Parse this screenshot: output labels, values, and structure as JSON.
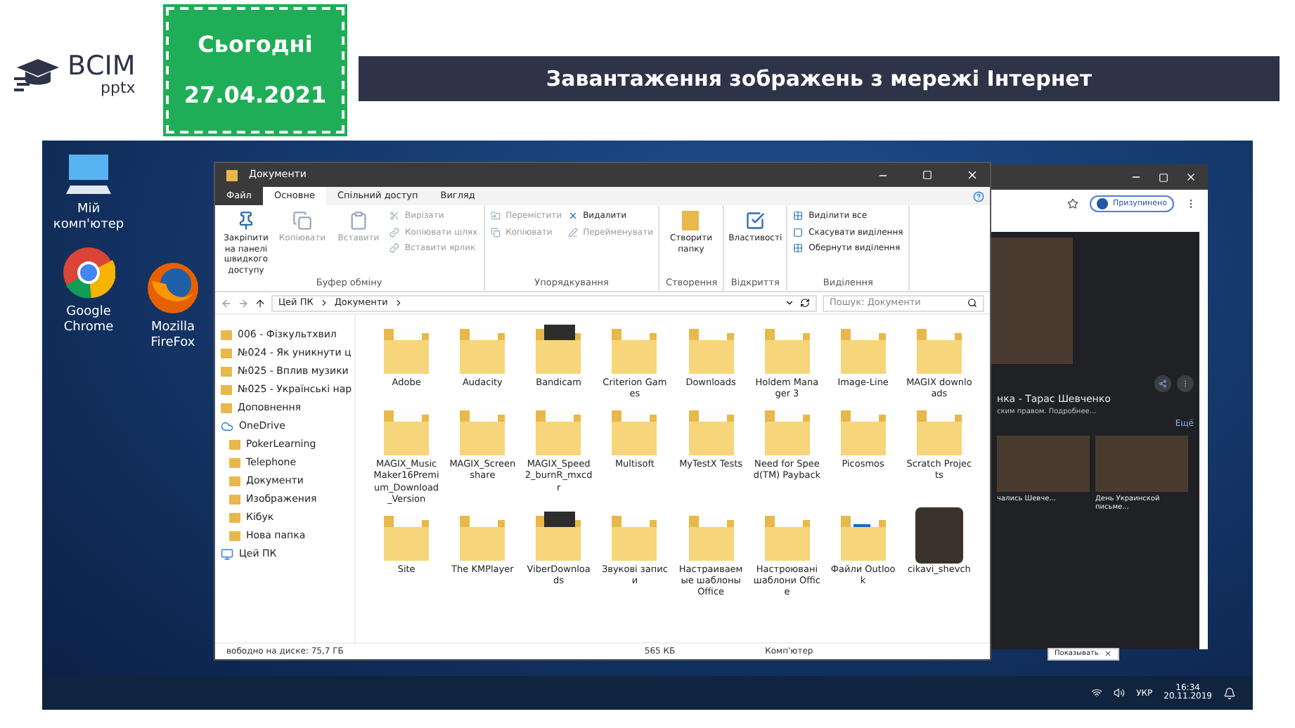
{
  "logo": {
    "title": "ВСІМ",
    "subtitle": "pptx"
  },
  "date_card": {
    "label": "Сьогодні",
    "date": "27.04.2021"
  },
  "title": "Завантаження зображень з мережі Інтернет",
  "desktop_icons": [
    {
      "kind": "computer",
      "label": "Мій комп'ютер"
    },
    {
      "kind": "chrome",
      "label": "Google Chrome"
    },
    {
      "kind": "firefox",
      "label": "Mozilla FireFox"
    }
  ],
  "explorer": {
    "title": "Документи",
    "tabs": [
      {
        "label": "Файл",
        "kind": "file",
        "selected": false
      },
      {
        "label": "Основне",
        "kind": "tab",
        "selected": true
      },
      {
        "label": "Спільний доступ",
        "kind": "tab",
        "selected": false
      },
      {
        "label": "Вигляд",
        "kind": "tab",
        "selected": false
      }
    ],
    "ribbon": [
      {
        "label": "Буфер обміну",
        "items": [
          {
            "kind": "pin",
            "label": "Закріпити на панелі швидкого доступу",
            "disabled": false
          },
          {
            "kind": "copy",
            "label": "Копіювати",
            "disabled": true
          },
          {
            "kind": "paste",
            "label": "Вставити",
            "disabled": true
          },
          {
            "kind": "cut",
            "label": "Вирізати",
            "disabled": true
          },
          {
            "kind": "path",
            "label": "Копіювати шлях",
            "disabled": true
          },
          {
            "kind": "shortcut",
            "label": "Вставити ярлик",
            "disabled": true
          }
        ]
      },
      {
        "label": "Упорядкування",
        "items": [
          {
            "kind": "move",
            "label": "Перемістити",
            "disabled": true
          },
          {
            "kind": "copyto",
            "label": "Копіювати",
            "disabled": true
          },
          {
            "kind": "delete",
            "label": "Видалити",
            "disabled": false
          },
          {
            "kind": "rename",
            "label": "Перейменувати",
            "disabled": true
          }
        ]
      },
      {
        "label": "Створення",
        "items": [
          {
            "kind": "newfolder",
            "label": "Створити папку",
            "disabled": false
          }
        ]
      },
      {
        "label": "Відкриття",
        "items": [
          {
            "kind": "properties",
            "label": "Властивості",
            "disabled": false
          }
        ]
      },
      {
        "label": "Виділення",
        "items": [
          {
            "kind": "selectall",
            "label": "Виділити все",
            "disabled": false
          },
          {
            "kind": "selectnone",
            "label": "Скасувати виділення",
            "disabled": false
          },
          {
            "kind": "invert",
            "label": "Обернути виділення",
            "disabled": false
          }
        ]
      }
    ],
    "breadcrumb": [
      "Цей ПК",
      "Документи"
    ],
    "search": {
      "placeholder": "Пошук: Документи"
    },
    "nav": [
      {
        "label": "006 - Фізкультхвил",
        "kind": "folder"
      },
      {
        "label": "№024 - Як уникнути ц",
        "kind": "folder"
      },
      {
        "label": "№025 - Вплив музики",
        "kind": "folder"
      },
      {
        "label": "№025 - Українські нар",
        "kind": "folder"
      },
      {
        "label": "Доповнення",
        "kind": "folder"
      },
      {
        "label": "OneDrive",
        "kind": "cloud",
        "children": [
          {
            "label": "PokerLearning",
            "kind": "folder"
          },
          {
            "label": "Telephone",
            "kind": "folder"
          },
          {
            "label": "Документи",
            "kind": "folder"
          },
          {
            "label": "Изображения",
            "kind": "folder"
          },
          {
            "label": "Кібук",
            "kind": "folder"
          },
          {
            "label": "Нова папка",
            "kind": "folder"
          }
        ]
      },
      {
        "label": "Цей ПК",
        "kind": "pc"
      }
    ],
    "items": [
      {
        "name": "Adobe",
        "kind": "folder"
      },
      {
        "name": "Audacity",
        "kind": "folder"
      },
      {
        "name": "Bandicam",
        "kind": "dark"
      },
      {
        "name": "Criterion Games",
        "kind": "folder"
      },
      {
        "name": "Downloads",
        "kind": "folder"
      },
      {
        "name": "Holdem Manager 3",
        "kind": "folder"
      },
      {
        "name": "Image-Line",
        "kind": "folder"
      },
      {
        "name": "MAGIX downloads",
        "kind": "folder"
      },
      {
        "name": "MAGIX_MusicMaker16Premium_Download_Version",
        "kind": "folder"
      },
      {
        "name": "MAGIX_Screenshare",
        "kind": "folder"
      },
      {
        "name": "MAGIX_Speed2_burnR_mxcdr",
        "kind": "folder"
      },
      {
        "name": "Multisoft",
        "kind": "folder"
      },
      {
        "name": "MyTestX Tests",
        "kind": "folder"
      },
      {
        "name": "Need for Speed(TM) Payback",
        "kind": "folder"
      },
      {
        "name": "Picosmos",
        "kind": "folder"
      },
      {
        "name": "Scratch Projects",
        "kind": "folder"
      },
      {
        "name": "Site",
        "kind": "folder"
      },
      {
        "name": "The KMPlayer",
        "kind": "folder"
      },
      {
        "name": "ViberDownloads",
        "kind": "dark"
      },
      {
        "name": "Звукові записи",
        "kind": "folder"
      },
      {
        "name": "Настраиваемые шаблоны Office",
        "kind": "folder"
      },
      {
        "name": "Настроювані шаблони Office",
        "kind": "folder"
      },
      {
        "name": "Файли Outlook",
        "kind": "outlook"
      },
      {
        "name": "cikavi_shevch",
        "kind": "photo"
      }
    ],
    "status": {
      "free": "вободно на диске: 75,7 ГБ",
      "size": "565 КБ",
      "location": "Комп'ютер"
    }
  },
  "browser": {
    "profile": "Призупинено",
    "heading": "нка - Тарас Шевченко",
    "subtext": "ским правом. Подробнее...",
    "more": "Ещё",
    "captions": [
      "чались Шевче...",
      "День Украинской письме..."
    ],
    "popup": "Показывать"
  },
  "taskbar": {
    "lang": "УКР",
    "time": "16:34",
    "date": "20.11.2019"
  }
}
